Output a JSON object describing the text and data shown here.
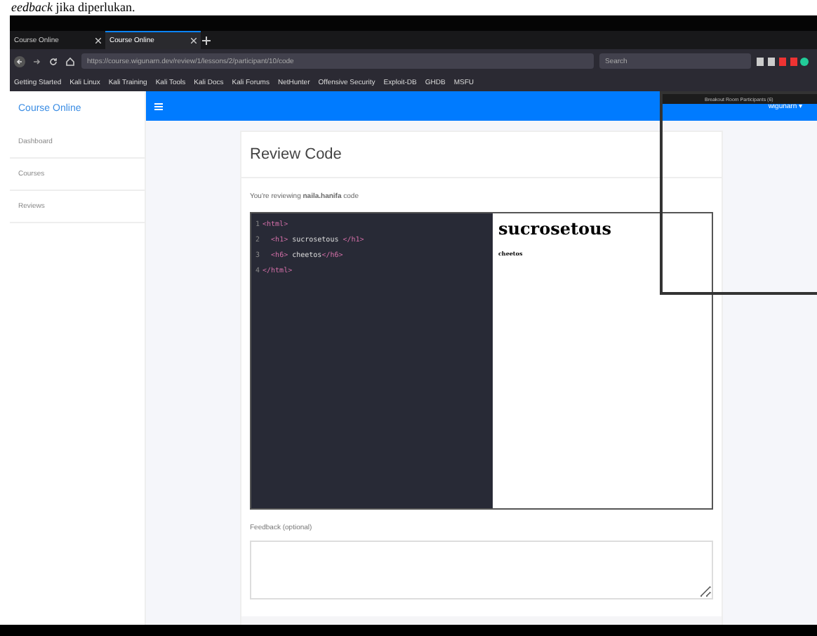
{
  "document_text": "*eedback* jika diperlukan.",
  "browser": {
    "tabs": [
      {
        "label": "Course Online",
        "selected": false
      },
      {
        "label": "Course Online",
        "selected": true
      }
    ],
    "url": "https://course.wigunarn.dev/review/1/lessons/2/participant/10/code",
    "search": {
      "placeholder": "Search"
    },
    "bookmarks": [
      "Getting Started",
      "Kali Linux",
      "Kali Training",
      "Kali Tools",
      "Kali Docs",
      "Kali Forums",
      "NetHunter",
      "Offensive Security",
      "Exploit-DB",
      "GHDB",
      "MSFU"
    ]
  },
  "app": {
    "brand": "Course Online",
    "user_menu": "wigunarn ▾",
    "sidebar": {
      "items": [
        {
          "label": "Dashboard",
          "selected": false
        },
        {
          "label": "Courses",
          "selected": false
        },
        {
          "label": "Reviews",
          "selected": false
        }
      ]
    },
    "title": "Review Code",
    "subtitle": "You're reviewing **naila.hanifa** code",
    "code_lines": [
      {
        "number": "1",
        "text": "<html>"
      },
      {
        "number": "2",
        "text": "  <h1> sucrosetous </h1>"
      },
      {
        "number": "3",
        "text": "  <h6> cheetos</h6>"
      },
      {
        "number": "4",
        "text": "</html>"
      }
    ],
    "preview": {
      "heading": "sucrosetous",
      "small": "cheetos"
    },
    "feedback": {
      "label": "Feedback (optional)"
    }
  },
  "overlay": {
    "title": "Breakout Room Participants (6)"
  }
}
